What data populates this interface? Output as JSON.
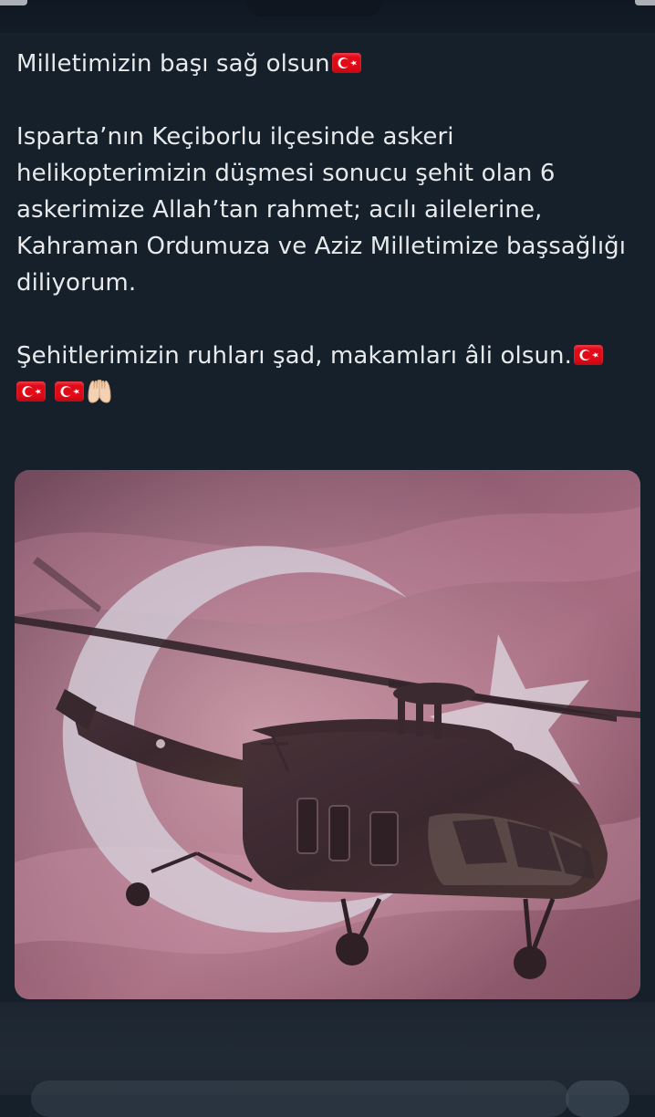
{
  "tweet": {
    "line1": "Milletimizin başı sağ olsun",
    "paragraph2": "Isparta’nın Keçiborlu ilçesinde askeri helikopterimizin düşmesi sonucu şehit olan 6 askerimize Allah’tan rahmet; acılı ailelerine, Kahraman Ordumuza ve Aziz Milletimize başsağlığı diliyorum.",
    "paragraph3": "Şehitlerimizin ruhları şad, makamları âli olsun."
  },
  "emoji": {
    "flag": "flag-turkey-icon",
    "hands": "palms-up-together-icon"
  },
  "colors": {
    "background": "#15202b",
    "text": "#e7e9ea",
    "flag_red": "#e30a17"
  }
}
